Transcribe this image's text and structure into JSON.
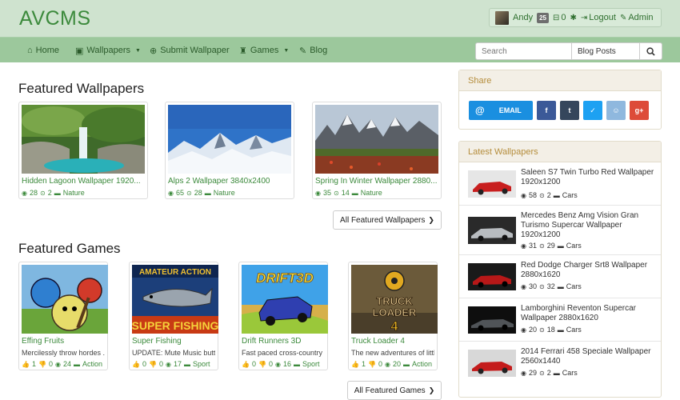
{
  "header": {
    "brand": "AVCMS",
    "user": {
      "name": "Andy",
      "badge": "25",
      "inbox_count": "0",
      "logout_label": "Logout",
      "admin_label": "Admin"
    }
  },
  "nav": {
    "items": [
      {
        "label": "Home",
        "icon": "home-icon"
      },
      {
        "label": "Wallpapers",
        "icon": "picture-icon"
      },
      {
        "label": "Submit Wallpaper",
        "icon": "upload-icon"
      },
      {
        "label": "Games",
        "icon": "tower-icon"
      },
      {
        "label": "Blog",
        "icon": "pencil-icon"
      }
    ],
    "search": {
      "placeholder": "Search",
      "scope": "Blog Posts"
    }
  },
  "featured_wallpapers": {
    "title": "Featured Wallpapers",
    "button": "All Featured Wallpapers",
    "items": [
      {
        "title": "Hidden Lagoon Wallpaper 1920...",
        "views": "28",
        "downloads": "2",
        "category": "Nature"
      },
      {
        "title": "Alps 2 Wallpaper 3840x2400",
        "views": "65",
        "downloads": "28",
        "category": "Nature"
      },
      {
        "title": "Spring In Winter Wallpaper 2880...",
        "views": "35",
        "downloads": "14",
        "category": "Nature"
      }
    ]
  },
  "featured_games": {
    "title": "Featured Games",
    "button": "All Featured Games",
    "items": [
      {
        "title": "Effing Fruits",
        "desc": "Mercilessly throw hordes ...",
        "likes": "1",
        "dislikes": "0",
        "plays": "24",
        "category": "Action"
      },
      {
        "title": "Super Fishing",
        "desc": "UPDATE: Mute Music butt...",
        "likes": "0",
        "dislikes": "0",
        "plays": "17",
        "category": "Sport"
      },
      {
        "title": "Drift Runners 3D",
        "desc": "Fast paced cross-country ...",
        "likes": "0",
        "dislikes": "0",
        "plays": "16",
        "category": "Sport"
      },
      {
        "title": "Truck Loader 4",
        "desc": "The new adventures of littl...",
        "likes": "1",
        "dislikes": "0",
        "plays": "20",
        "category": "Action"
      }
    ]
  },
  "share": {
    "title": "Share",
    "email_label": "EMAIL",
    "buttons": [
      {
        "name": "facebook",
        "glyph": "f",
        "color": "#3b5998"
      },
      {
        "name": "tumblr",
        "glyph": "t",
        "color": "#35465c"
      },
      {
        "name": "twitter",
        "glyph": "✓",
        "color": "#1da1f2"
      },
      {
        "name": "reddit",
        "glyph": "☺",
        "color": "#8fb8de"
      },
      {
        "name": "google-plus",
        "glyph": "g+",
        "color": "#dd4b39"
      }
    ]
  },
  "latest_wallpapers": {
    "title": "Latest Wallpapers",
    "items": [
      {
        "title": "Saleen S7 Twin Turbo Red Wallpaper 1920x1200",
        "views": "58",
        "downloads": "2",
        "category": "Cars"
      },
      {
        "title": "Mercedes Benz Amg Vision Gran Turismo Supercar Wallpaper 1920x1200",
        "views": "31",
        "downloads": "29",
        "category": "Cars"
      },
      {
        "title": "Red Dodge Charger Srt8 Wallpaper 2880x1620",
        "views": "30",
        "downloads": "32",
        "category": "Cars"
      },
      {
        "title": "Lamborghini Reventon Supercar Wallpaper 2880x1620",
        "views": "20",
        "downloads": "18",
        "category": "Cars"
      },
      {
        "title": "2014 Ferrari 458 Speciale Wallpaper 2560x1440",
        "views": "29",
        "downloads": "2",
        "category": "Cars"
      }
    ]
  }
}
